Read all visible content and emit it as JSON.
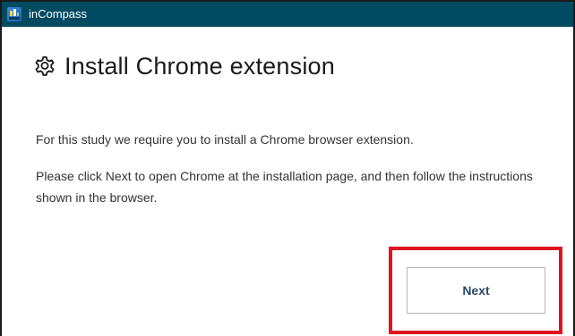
{
  "window": {
    "title": "inCompass",
    "icon": "incompass-app-icon"
  },
  "heading": {
    "icon": "gear-icon",
    "text": "Install Chrome extension"
  },
  "body": {
    "paragraph1": "For this study we require you to install a Chrome browser extension.",
    "paragraph2": "Please click Next to open Chrome at the installation page, and then follow the instructions shown in the browser."
  },
  "actions": {
    "next_label": "Next"
  },
  "colors": {
    "titlebar": "#004b62",
    "highlight": "#e0141e",
    "button_text": "#2b4a6b"
  }
}
